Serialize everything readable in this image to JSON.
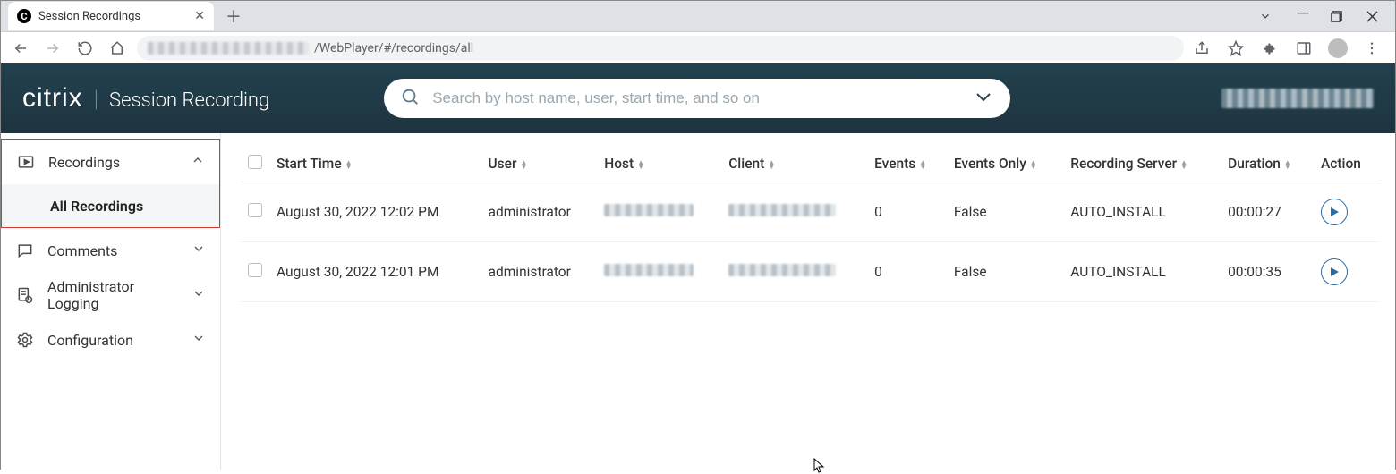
{
  "browser": {
    "tab_title": "Session Recordings",
    "url_visible_suffix": "/WebPlayer/#/recordings/all"
  },
  "header": {
    "brand": "citrix",
    "app_title": "Session Recording",
    "search_placeholder": "Search by host name, user, start time, and so on"
  },
  "sidebar": {
    "items": [
      {
        "label": "Recordings",
        "expanded": true
      },
      {
        "label": "Comments",
        "expanded": false
      },
      {
        "label": "Administrator Logging",
        "expanded": false
      },
      {
        "label": "Configuration",
        "expanded": false
      }
    ],
    "sub_item_label": "All Recordings"
  },
  "table": {
    "columns": {
      "start_time": "Start Time",
      "user": "User",
      "host": "Host",
      "client": "Client",
      "events": "Events",
      "events_only": "Events Only",
      "recording_server": "Recording Server",
      "duration": "Duration",
      "action": "Action"
    },
    "rows": [
      {
        "start_time": "August 30, 2022 12:02 PM",
        "user": "administrator",
        "events": "0",
        "events_only": "False",
        "recording_server": "AUTO_INSTALL",
        "duration": "00:00:27"
      },
      {
        "start_time": "August 30, 2022 12:01 PM",
        "user": "administrator",
        "events": "0",
        "events_only": "False",
        "recording_server": "AUTO_INSTALL",
        "duration": "00:00:35"
      }
    ]
  }
}
